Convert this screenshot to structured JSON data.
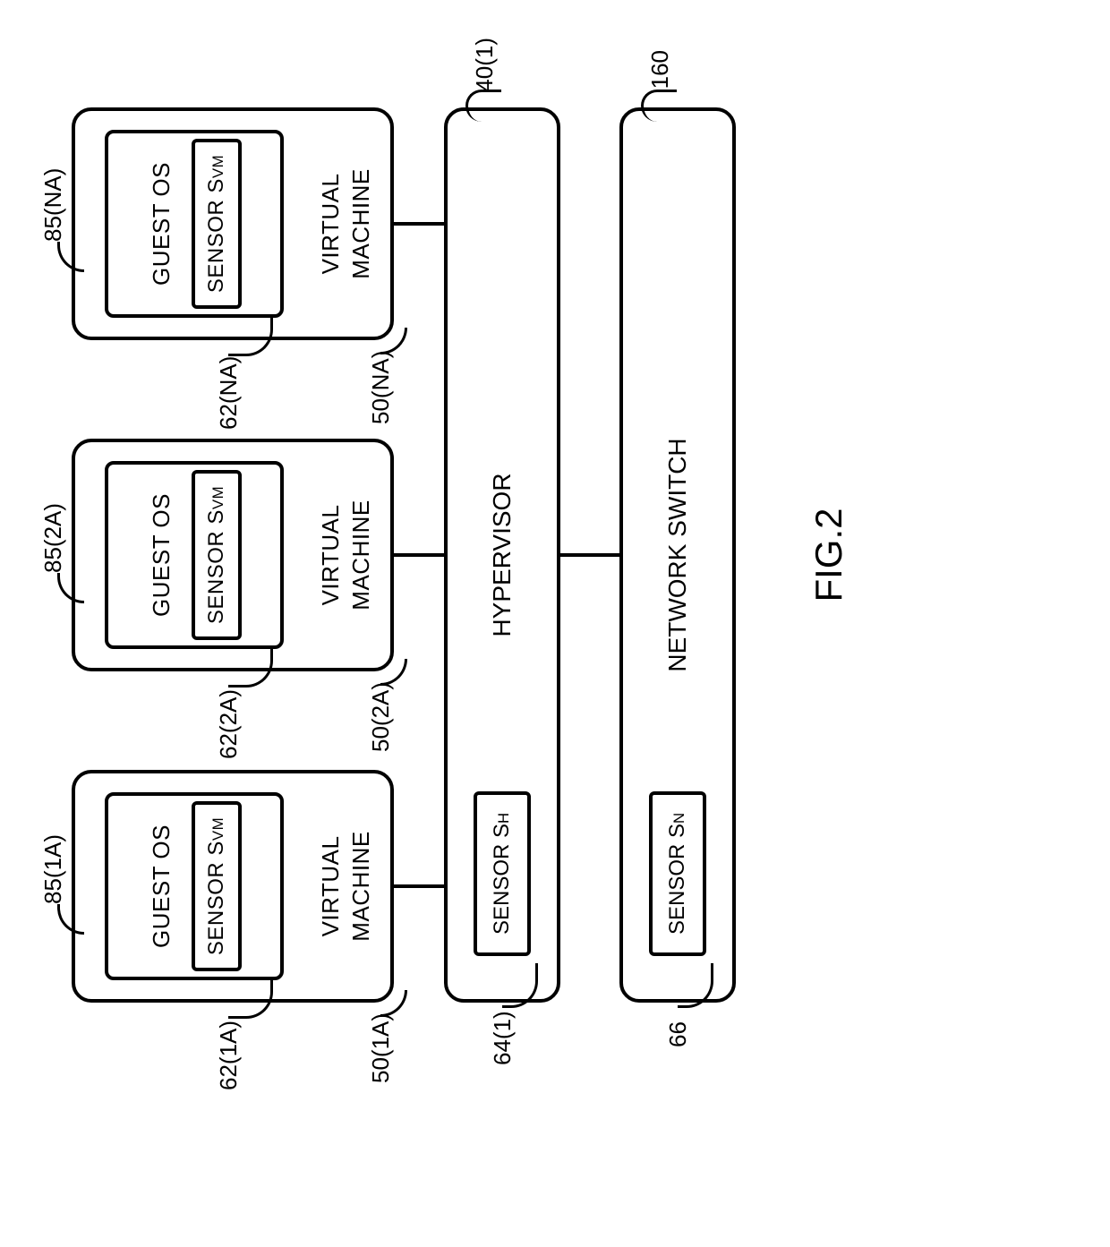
{
  "figure_label": "FIG.2",
  "vms": [
    {
      "os_ref": "85(1A)",
      "sensor_ref": "62(1A)",
      "vm_ref": "50(1A)",
      "os_label": "GUEST OS",
      "sensor_label_html": "SENSOR S<sub>VM</sub>",
      "vm_label": "VIRTUAL\nMACHINE"
    },
    {
      "os_ref": "85(2A)",
      "sensor_ref": "62(2A)",
      "vm_ref": "50(2A)",
      "os_label": "GUEST OS",
      "sensor_label_html": "SENSOR S<sub>VM</sub>",
      "vm_label": "VIRTUAL\nMACHINE"
    },
    {
      "os_ref": "85(NA)",
      "sensor_ref": "62(NA)",
      "vm_ref": "50(NA)",
      "os_label": "GUEST OS",
      "sensor_label_html": "SENSOR S<sub>VM</sub>",
      "vm_label": "VIRTUAL\nMACHINE"
    }
  ],
  "hypervisor": {
    "label": "HYPERVISOR",
    "ref": "40(1)",
    "sensor_label_html": "SENSOR S<sub>H</sub>",
    "sensor_ref": "64(1)"
  },
  "switch": {
    "label": "NETWORK SWITCH",
    "ref": "160",
    "sensor_label_html": "SENSOR S<sub>N</sub>",
    "sensor_ref": "66"
  }
}
